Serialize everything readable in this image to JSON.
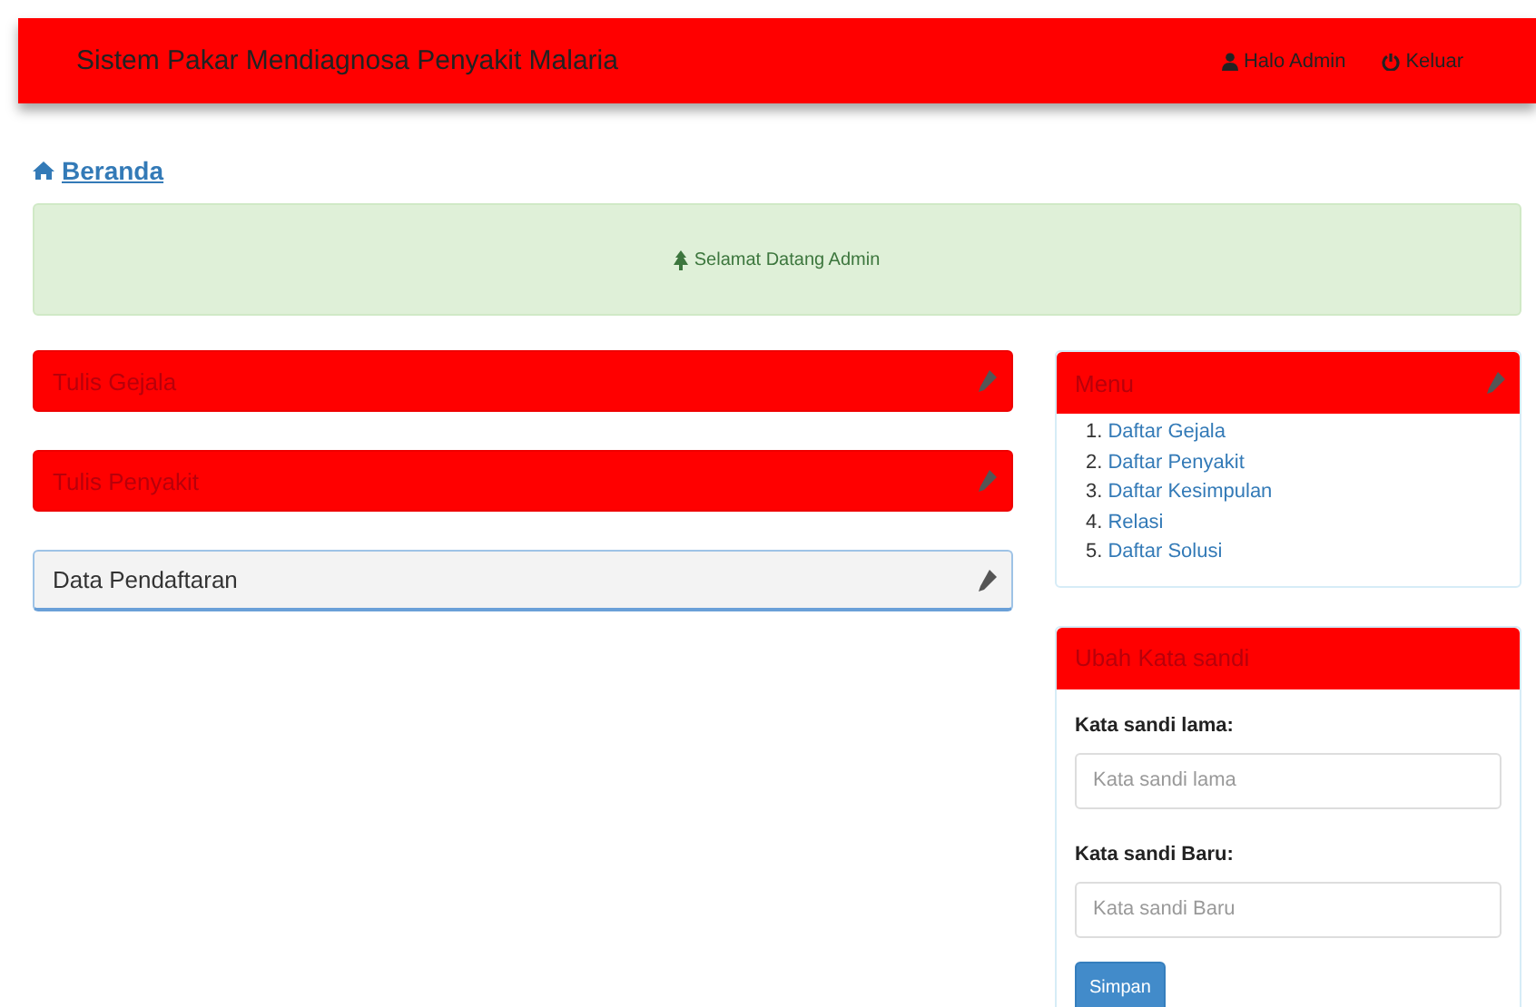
{
  "navbar": {
    "title": "Sistem Pakar Mendiagnosa Penyakit Malaria",
    "links": [
      {
        "kind": "user",
        "label": "Halo Admin"
      },
      {
        "kind": "power",
        "label": "Keluar"
      }
    ]
  },
  "breadcrumb": {
    "label": "Beranda"
  },
  "alert": {
    "text": "Selamat Datang Admin"
  },
  "left_panels": [
    {
      "title": "Tulis Gejala",
      "kind": "primary"
    },
    {
      "title": "Tulis Penyakit",
      "kind": "primary"
    },
    {
      "title": "Data Pendaftaran",
      "kind": "default"
    }
  ],
  "menu_panel": {
    "title": "Menu",
    "items": [
      {
        "number": "1.",
        "label": "Daftar Gejala"
      },
      {
        "number": "2.",
        "label": "Daftar Penyakit"
      },
      {
        "number": "3.",
        "label": "Daftar Kesimpulan"
      },
      {
        "number": "4.",
        "label": "Relasi"
      },
      {
        "number": "5.",
        "label": "Daftar Solusi"
      }
    ]
  },
  "password_panel": {
    "title": "Ubah Kata sandi",
    "fields": [
      {
        "label": "Kata sandi lama:",
        "placeholder": "Kata sandi lama"
      },
      {
        "label": "Kata sandi Baru:",
        "placeholder": "Kata sandi Baru"
      }
    ],
    "button": "Simpan"
  }
}
